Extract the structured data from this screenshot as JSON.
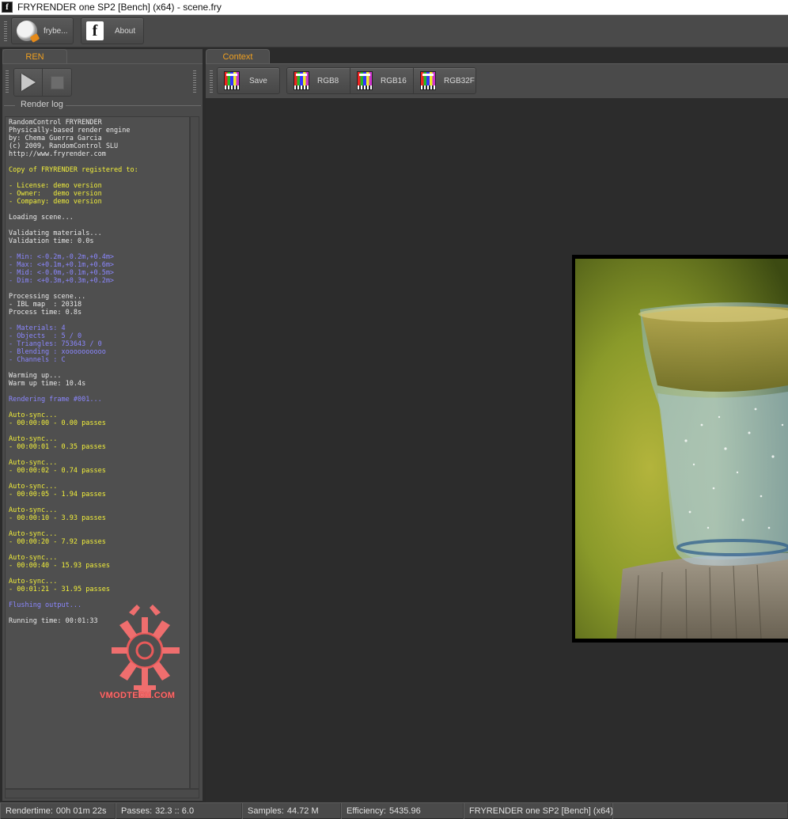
{
  "window": {
    "title": "FRYRENDER one SP2 [Bench] (x64) - scene.fry"
  },
  "toolbar": {
    "frybench_label": "frybe...",
    "about_label": "About"
  },
  "ren_panel": {
    "tab_label": "REN",
    "group_label": "Render log",
    "log_lines": [
      {
        "text": "RandomControl FRYRENDER",
        "color": "w"
      },
      {
        "text": "Physically-based render engine",
        "color": "w"
      },
      {
        "text": "by: Chema Guerra Garcia",
        "color": "w"
      },
      {
        "text": "(c) 2009, RandomControl SLU",
        "color": "w"
      },
      {
        "text": "http://www.fryrender.com",
        "color": "w"
      },
      {
        "text": "",
        "color": "w"
      },
      {
        "text": "Copy of FRYRENDER registered to:",
        "color": "y"
      },
      {
        "text": "",
        "color": "w"
      },
      {
        "text": "- License: demo version",
        "color": "y"
      },
      {
        "text": "- Owner:   demo version",
        "color": "y"
      },
      {
        "text": "- Company: demo version",
        "color": "y"
      },
      {
        "text": "",
        "color": "w"
      },
      {
        "text": "Loading scene...",
        "color": "w"
      },
      {
        "text": "",
        "color": "w"
      },
      {
        "text": "Validating materials...",
        "color": "w"
      },
      {
        "text": "Validation time: 0.0s",
        "color": "w"
      },
      {
        "text": "",
        "color": "w"
      },
      {
        "text": "- Min: <-0.2m,-0.2m,+0.4m>",
        "color": "b"
      },
      {
        "text": "- Max: <+0.1m,+0.1m,+0.6m>",
        "color": "b"
      },
      {
        "text": "- Mid: <-0.0m,-0.1m,+0.5m>",
        "color": "b"
      },
      {
        "text": "- Dim: <+0.3m,+0.3m,+0.2m>",
        "color": "b"
      },
      {
        "text": "",
        "color": "w"
      },
      {
        "text": "Processing scene...",
        "color": "w"
      },
      {
        "text": "- IBL map  : 20318",
        "color": "w"
      },
      {
        "text": "Process time: 0.8s",
        "color": "w"
      },
      {
        "text": "",
        "color": "w"
      },
      {
        "text": "- Materials: 4",
        "color": "b"
      },
      {
        "text": "- Objects  : 5 / 0",
        "color": "b"
      },
      {
        "text": "- Triangles: 753643 / 0",
        "color": "b"
      },
      {
        "text": "- Blending : xoooooooooo",
        "color": "b"
      },
      {
        "text": "- Channels : C",
        "color": "b"
      },
      {
        "text": "",
        "color": "w"
      },
      {
        "text": "Warming up...",
        "color": "w"
      },
      {
        "text": "Warm up time: 10.4s",
        "color": "w"
      },
      {
        "text": "",
        "color": "w"
      },
      {
        "text": "Rendering frame #001...",
        "color": "b"
      },
      {
        "text": "",
        "color": "w"
      },
      {
        "text": "Auto-sync...",
        "color": "y"
      },
      {
        "text": "- 00:00:00 - 0.00 passes",
        "color": "y"
      },
      {
        "text": "",
        "color": "w"
      },
      {
        "text": "Auto-sync...",
        "color": "y"
      },
      {
        "text": "- 00:00:01 - 0.35 passes",
        "color": "y"
      },
      {
        "text": "",
        "color": "w"
      },
      {
        "text": "Auto-sync...",
        "color": "y"
      },
      {
        "text": "- 00:00:02 - 0.74 passes",
        "color": "y"
      },
      {
        "text": "",
        "color": "w"
      },
      {
        "text": "Auto-sync...",
        "color": "y"
      },
      {
        "text": "- 00:00:05 - 1.94 passes",
        "color": "y"
      },
      {
        "text": "",
        "color": "w"
      },
      {
        "text": "Auto-sync...",
        "color": "y"
      },
      {
        "text": "- 00:00:10 - 3.93 passes",
        "color": "y"
      },
      {
        "text": "",
        "color": "w"
      },
      {
        "text": "Auto-sync...",
        "color": "y"
      },
      {
        "text": "- 00:00:20 - 7.92 passes",
        "color": "y"
      },
      {
        "text": "",
        "color": "w"
      },
      {
        "text": "Auto-sync...",
        "color": "y"
      },
      {
        "text": "- 00:00:40 - 15.93 passes",
        "color": "y"
      },
      {
        "text": "",
        "color": "w"
      },
      {
        "text": "Auto-sync...",
        "color": "y"
      },
      {
        "text": "- 00:01:21 - 31.95 passes",
        "color": "y"
      },
      {
        "text": "",
        "color": "w"
      },
      {
        "text": "Flushing output...",
        "color": "b"
      },
      {
        "text": "",
        "color": "w"
      },
      {
        "text": "Running time: 00:01:33",
        "color": "w"
      }
    ],
    "watermark_text": "VMODTECH.COM"
  },
  "context_panel": {
    "tab_label": "Context",
    "buttons": [
      {
        "label": "Save"
      },
      {
        "label": "RGB8"
      },
      {
        "label": "RGB16"
      },
      {
        "label": "RGB32F"
      }
    ]
  },
  "status": {
    "rendertime_label": "Rendertime:",
    "rendertime_value": "00h 01m 22s",
    "passes_label": "Passes:",
    "passes_value": "32.3 :: 6.0",
    "samples_label": "Samples:",
    "samples_value": "44.72 M",
    "efficiency_label": "Efficiency:",
    "efficiency_value": "5435.96",
    "product": "FRYRENDER one SP2 [Bench] (x64)"
  },
  "colors": {
    "accent_tab": "#f0a020",
    "log_white": "#e8e8e8",
    "log_yellow": "#f2ef3a",
    "log_blue": "#8b87ff",
    "watermark": "#ff6b6b"
  }
}
